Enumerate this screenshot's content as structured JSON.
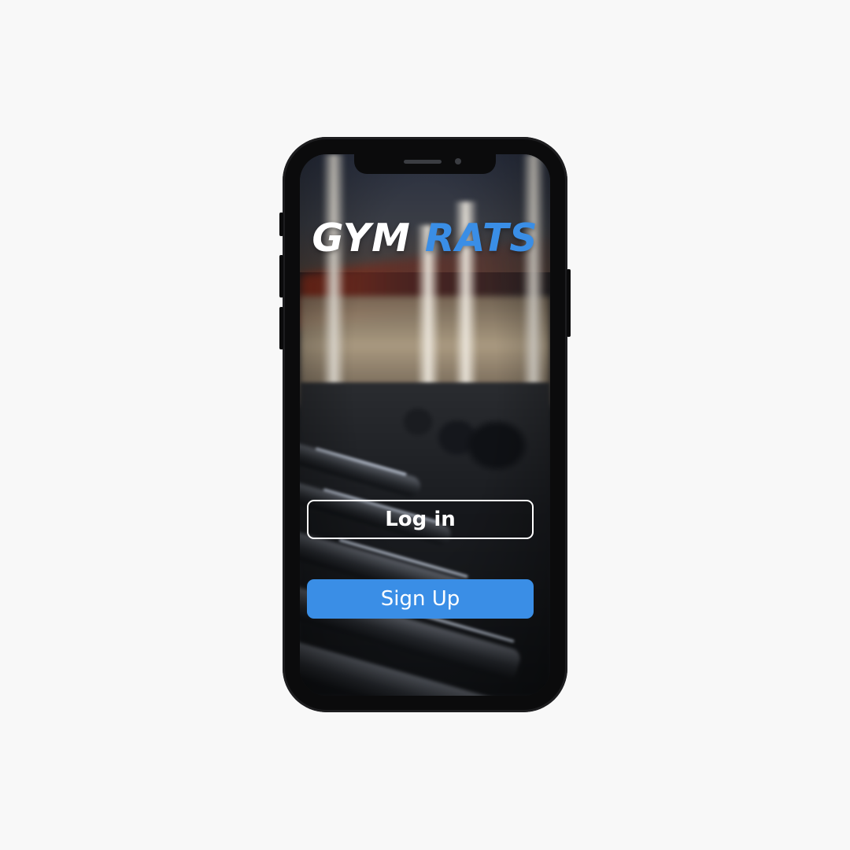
{
  "app": {
    "logo_word_1": "GYM",
    "logo_word_2": "RATS"
  },
  "actions": {
    "login_label": "Log in",
    "signup_label": "Sign Up"
  },
  "colors": {
    "accent": "#3a8ee6",
    "logo_primary": "#ffffff",
    "page_background": "#f8f8f8",
    "phone_frame": "#0b0b0c"
  },
  "background_image": {
    "subject": "blurred gym dumbbell rack"
  }
}
